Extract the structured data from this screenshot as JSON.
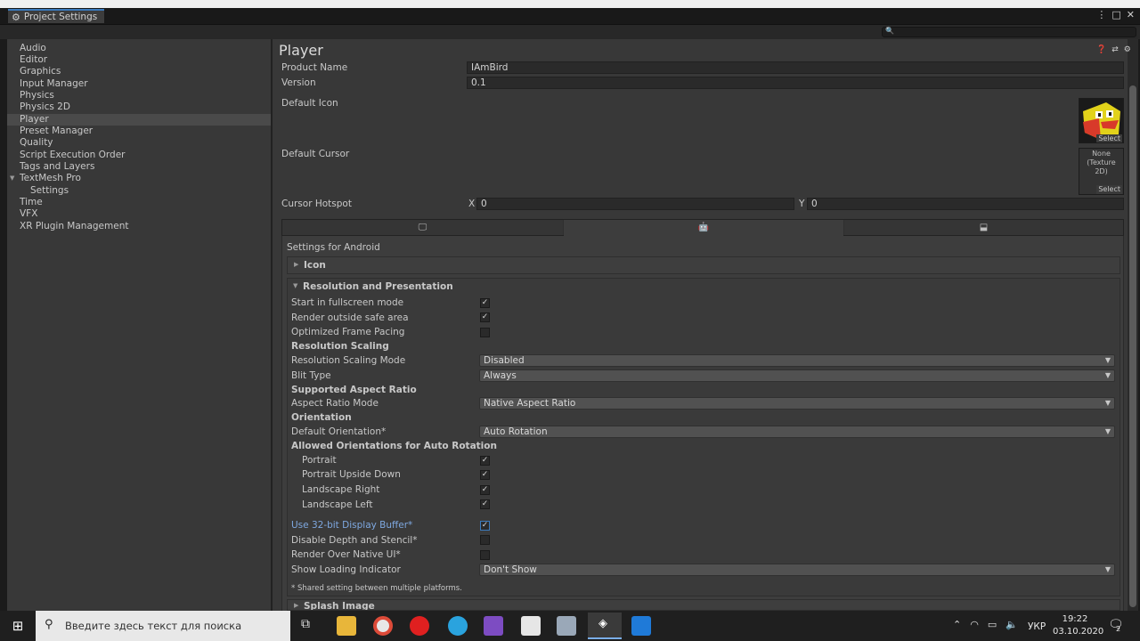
{
  "window": {
    "tab_title": "Project Settings"
  },
  "sidebar": {
    "items": [
      {
        "label": "Audio"
      },
      {
        "label": "Editor"
      },
      {
        "label": "Graphics"
      },
      {
        "label": "Input Manager"
      },
      {
        "label": "Physics"
      },
      {
        "label": "Physics 2D"
      },
      {
        "label": "Player"
      },
      {
        "label": "Preset Manager"
      },
      {
        "label": "Quality"
      },
      {
        "label": "Script Execution Order"
      },
      {
        "label": "Tags and Layers"
      },
      {
        "label": "TextMesh Pro"
      },
      {
        "label": "Settings"
      },
      {
        "label": "Time"
      },
      {
        "label": "VFX"
      },
      {
        "label": "XR Plugin Management"
      }
    ],
    "selected": "Player"
  },
  "player": {
    "title": "Player",
    "product_name_label": "Product Name",
    "product_name": "IAmBird",
    "version_label": "Version",
    "version": "0.1",
    "default_icon_label": "Default Icon",
    "select_label": "Select",
    "default_cursor_label": "Default Cursor",
    "cursor_none": "None",
    "cursor_type": "(Texture 2D)",
    "cursor_hotspot_label": "Cursor Hotspot",
    "hotspot_x_label": "X",
    "hotspot_x": "0",
    "hotspot_y_label": "Y",
    "hotspot_y": "0",
    "platform_tabs": [
      "standalone-icon",
      "android-icon",
      "webgl-icon"
    ],
    "settings_for": "Settings for Android"
  },
  "sections": {
    "icon": "Icon",
    "resolution": "Resolution and Presentation",
    "splash": "Splash Image"
  },
  "resolution": {
    "start_fullscreen": {
      "label": "Start in fullscreen mode",
      "checked": true
    },
    "render_outside_safe": {
      "label": "Render outside safe area",
      "checked": true
    },
    "optimized_frame_pacing": {
      "label": "Optimized Frame Pacing",
      "checked": false
    },
    "scaling_header": "Resolution Scaling",
    "scaling_mode": {
      "label": "Resolution Scaling Mode",
      "value": "Disabled"
    },
    "blit_type": {
      "label": "Blit Type",
      "value": "Always"
    },
    "aspect_header": "Supported Aspect Ratio",
    "aspect_mode": {
      "label": "Aspect Ratio Mode",
      "value": "Native Aspect Ratio"
    },
    "orientation_header": "Orientation",
    "default_orientation": {
      "label": "Default Orientation*",
      "value": "Auto Rotation"
    },
    "auto_rotation_header": "Allowed Orientations for Auto Rotation",
    "portrait": {
      "label": "Portrait",
      "checked": true
    },
    "portrait_upside": {
      "label": "Portrait Upside Down",
      "checked": true
    },
    "landscape_right": {
      "label": "Landscape Right",
      "checked": true
    },
    "landscape_left": {
      "label": "Landscape Left",
      "checked": true
    },
    "display_buffer": {
      "label": "Use 32-bit Display Buffer*",
      "checked": true
    },
    "disable_depth": {
      "label": "Disable Depth and Stencil*",
      "checked": false
    },
    "render_over_native": {
      "label": "Render Over Native UI*",
      "checked": false
    },
    "loading_indicator": {
      "label": "Show Loading Indicator",
      "value": "Don't Show"
    },
    "shared_note": "* Shared setting between multiple platforms."
  },
  "taskbar": {
    "search_placeholder": "Введите здесь текст для поиска",
    "lang": "УКР",
    "time": "19:22",
    "date": "03.10.2020",
    "notif_count": "2"
  },
  "colors": {
    "accent_blue": "#3a79bb",
    "link_blue": "#7ea8e0"
  }
}
